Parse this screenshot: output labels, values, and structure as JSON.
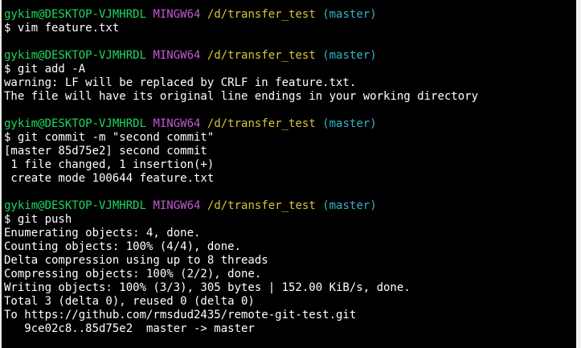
{
  "prompts": [
    {
      "user": "gykim@DESKTOP-VJMHRDL",
      "host": "MINGW64",
      "path": "/d/transfer_test",
      "branch": "(master)"
    },
    {
      "user": "gykim@DESKTOP-VJMHRDL",
      "host": "MINGW64",
      "path": "/d/transfer_test",
      "branch": "(master)"
    },
    {
      "user": "gykim@DESKTOP-VJMHRDL",
      "host": "MINGW64",
      "path": "/d/transfer_test",
      "branch": "(master)"
    },
    {
      "user": "gykim@DESKTOP-VJMHRDL",
      "host": "MINGW64",
      "path": "/d/transfer_test",
      "branch": "(master)"
    }
  ],
  "commands": [
    "$ vim feature.txt",
    "$ git add -A",
    "$ git commit -m \"second commit\"",
    "$ git push"
  ],
  "output": {
    "add": [
      "warning: LF will be replaced by CRLF in feature.txt.",
      "The file will have its original line endings in your working directory"
    ],
    "commit": [
      "[master 85d75e2] second commit",
      " 1 file changed, 1 insertion(+)",
      " create mode 100644 feature.txt"
    ],
    "push": [
      "Enumerating objects: 4, done.",
      "Counting objects: 100% (4/4), done.",
      "Delta compression using up to 8 threads",
      "Compressing objects: 100% (2/2), done.",
      "Writing objects: 100% (3/3), 305 bytes | 152.00 KiB/s, done.",
      "Total 3 (delta 0), reused 0 (delta 0)",
      "To https://github.com/rmsdud2435/remote-git-test.git",
      "   9ce02c8..85d75e2  master -> master"
    ]
  }
}
